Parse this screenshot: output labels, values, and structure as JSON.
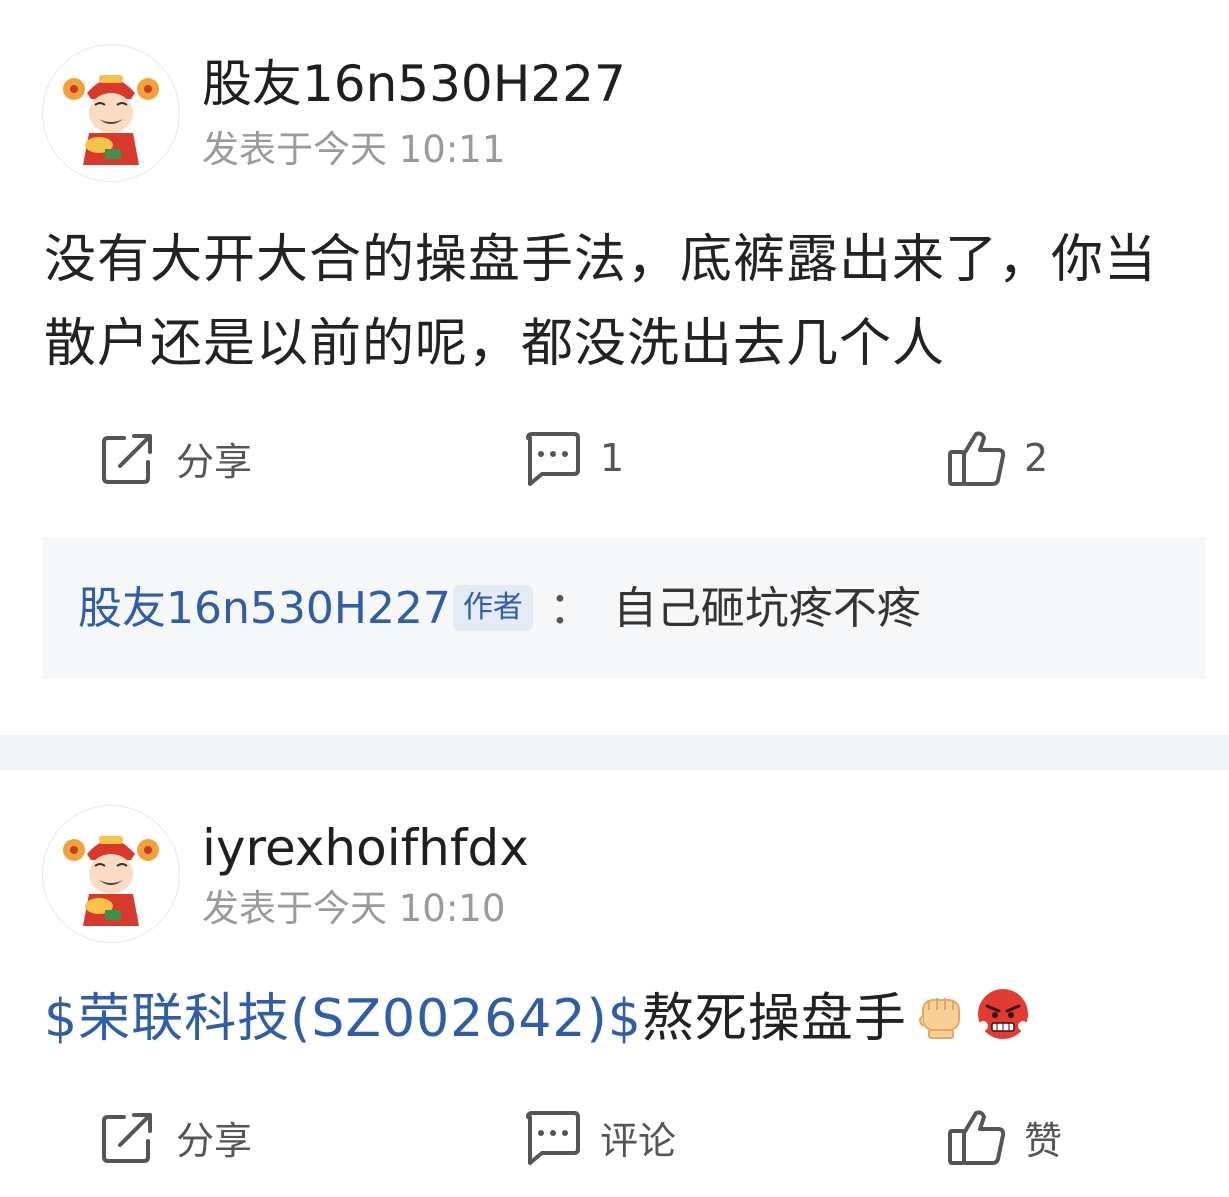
{
  "posts": [
    {
      "username": "股友16n530H227",
      "timestamp": "发表于今天 10:11",
      "content": "没有大开大合的操盘手法，底裤露出来了，你当散户还是以前的呢，都没洗出去几个人",
      "actions": {
        "share_label": "分享",
        "comment_label": "1",
        "like_label": "2"
      },
      "reply": {
        "author": "股友16n530H227",
        "badge": "作者",
        "separator": "：",
        "text": "自己砸坑疼不疼"
      }
    },
    {
      "username": "iyrexhoifhfdx",
      "timestamp": "发表于今天 10:10",
      "stock_link": "$荣联科技(SZ002642)$",
      "content": "熬死操盘手",
      "emojis": [
        "fist-emoji",
        "angry-face-emoji"
      ],
      "actions": {
        "share_label": "分享",
        "comment_label": "评论",
        "like_label": "赞"
      }
    }
  ],
  "icons": {
    "share": "share-icon",
    "comment": "comment-icon",
    "like": "thumbs-up-icon"
  },
  "colors": {
    "link_blue": "#2f5da8",
    "muted_text": "#9a9a9a",
    "reply_bg": "#f6f7f9",
    "divider": "#f3f4f6"
  }
}
